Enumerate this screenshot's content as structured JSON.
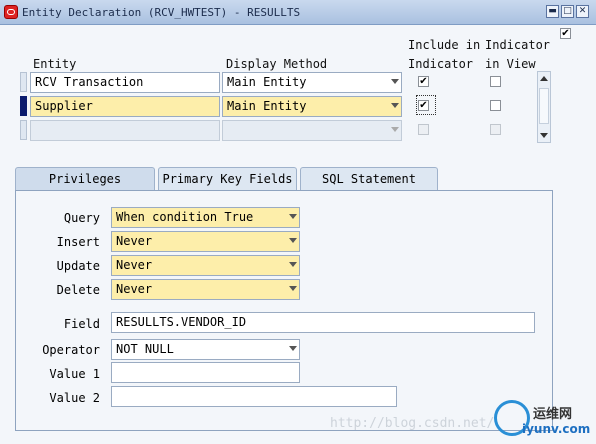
{
  "window": {
    "title": "Entity Declaration (RCV_HWTEST) - RESULLTS",
    "min_label": "▬",
    "max_label": "□",
    "close_label": "✕"
  },
  "grid": {
    "col_entity": "Entity",
    "col_display": "Display Method",
    "col_include_line1": "Include in",
    "col_include_line2": "Indicator",
    "col_indicator_line1": "Indicator",
    "col_indicator_line2": "in View",
    "header_checkbox_checked": true,
    "rows": [
      {
        "entity": "RCV Transaction",
        "display": "Main Entity",
        "include": true,
        "in_view": false,
        "current": false,
        "enabled": true
      },
      {
        "entity": "Supplier",
        "display": "Main Entity",
        "include": true,
        "in_view": false,
        "current": true,
        "enabled": true
      },
      {
        "entity": "",
        "display": "",
        "include": false,
        "in_view": false,
        "current": false,
        "enabled": false
      }
    ]
  },
  "tabs": [
    {
      "label": "Privileges",
      "active": true
    },
    {
      "label": "Primary Key Fields",
      "active": false
    },
    {
      "label": "SQL Statement",
      "active": false
    }
  ],
  "privileges": {
    "query_label": "Query",
    "query_value": "When condition True",
    "insert_label": "Insert",
    "insert_value": "Never",
    "update_label": "Update",
    "update_value": "Never",
    "delete_label": "Delete",
    "delete_value": "Never",
    "field_label": "Field",
    "field_value": "RESULLTS.VENDOR_ID",
    "operator_label": "Operator",
    "operator_value": "NOT NULL",
    "value1_label": "Value 1",
    "value1_value": "",
    "value2_label": "Value 2",
    "value2_value": ""
  },
  "watermark": {
    "text": "http://blog.csdn.net/",
    "logo_text": "运维网",
    "logo_sub": "iyunv.com"
  },
  "colors": {
    "required_field": "#fdeeaa",
    "current_row_marker": "#0b1b6e"
  }
}
